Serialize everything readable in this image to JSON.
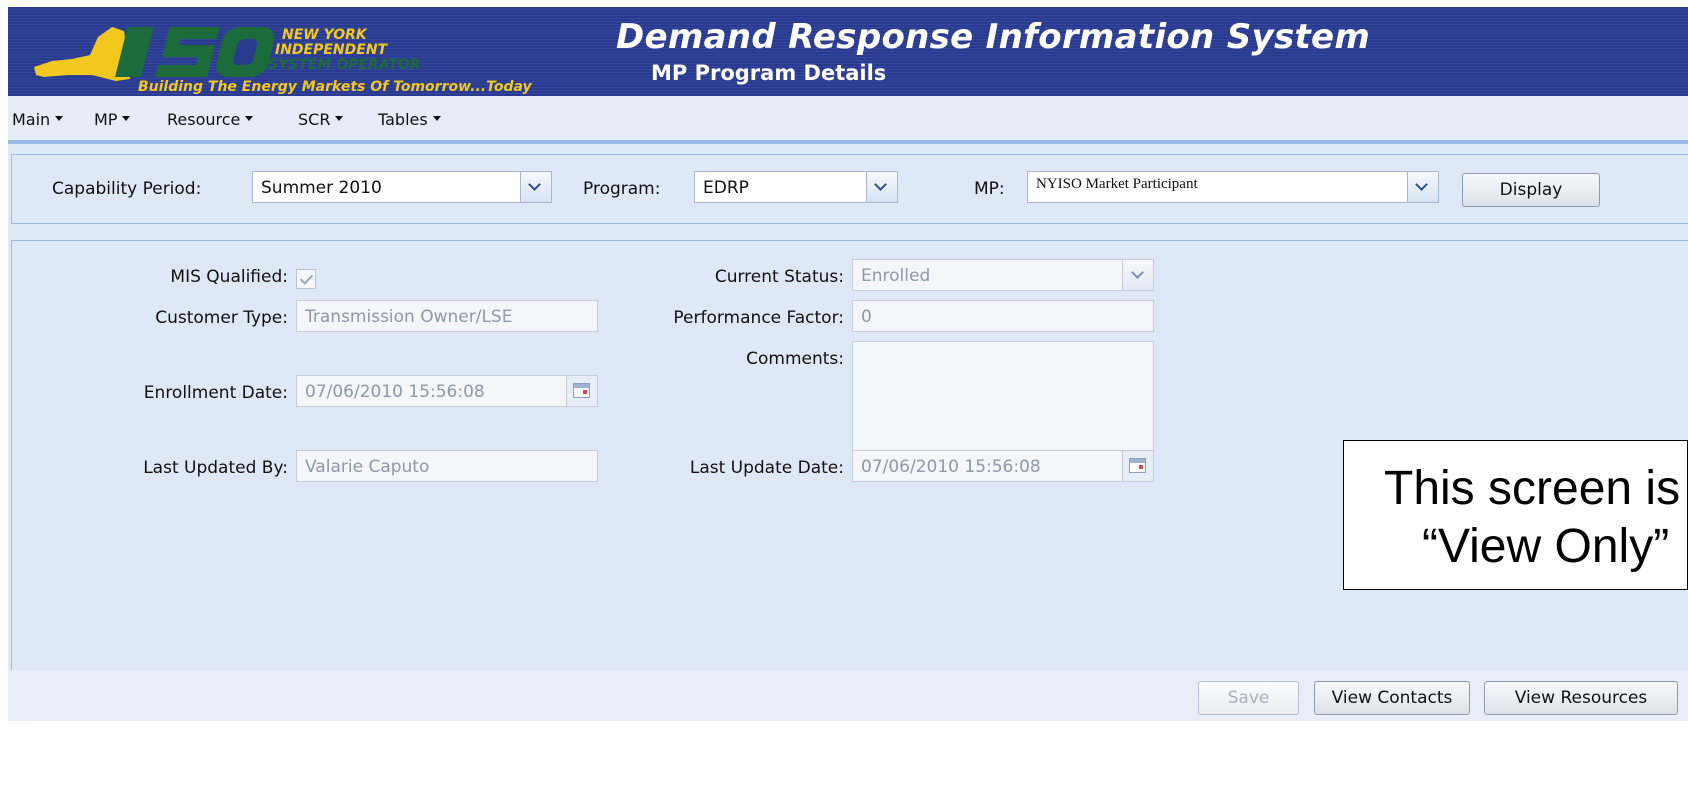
{
  "header": {
    "title": "Demand Response Information System",
    "subtitle": "MP Program Details",
    "logo": {
      "brand": "ISO",
      "line1": "NEW YORK",
      "line2": "INDEPENDENT",
      "line3": "SYSTEM OPERATOR",
      "tagline": "Building The Energy Markets Of Tomorrow...Today"
    }
  },
  "menu": {
    "items": [
      {
        "label": "Main"
      },
      {
        "label": "MP"
      },
      {
        "label": "Resource"
      },
      {
        "label": "SCR"
      },
      {
        "label": "Tables"
      }
    ]
  },
  "filters": {
    "capability_period": {
      "label": "Capability Period:",
      "value": "Summer 2010"
    },
    "program": {
      "label": "Program:",
      "value": "EDRP"
    },
    "mp": {
      "label": "MP:",
      "value": "NYISO Market Participant"
    },
    "display_button": "Display"
  },
  "details": {
    "mis_qualified": {
      "label": "MIS Qualified:",
      "checked": true
    },
    "customer_type": {
      "label": "Customer Type:",
      "value": "Transmission Owner/LSE"
    },
    "enrollment_date": {
      "label": "Enrollment Date:",
      "value": "07/06/2010 15:56:08"
    },
    "last_updated_by": {
      "label": "Last Updated By:",
      "value": "Valarie Caputo"
    },
    "current_status": {
      "label": "Current Status:",
      "value": "Enrolled"
    },
    "performance_factor": {
      "label": "Performance Factor:",
      "value": "0"
    },
    "comments": {
      "label": "Comments:",
      "value": ""
    },
    "last_update_date": {
      "label": "Last Update Date:",
      "value": "07/06/2010 15:56:08"
    }
  },
  "footer": {
    "save_button": "Save",
    "view_contacts_button": "View Contacts",
    "view_resources_button": "View Resources"
  },
  "callout": {
    "line1": "This screen is",
    "line2": "“View Only”"
  },
  "colors": {
    "header_bg": "#2a3a8e",
    "logo_yellow": "#f2c81e",
    "logo_green": "#1c6b3a",
    "panel_bg": "#dfe8f6",
    "panel_border": "#99bbe8"
  }
}
